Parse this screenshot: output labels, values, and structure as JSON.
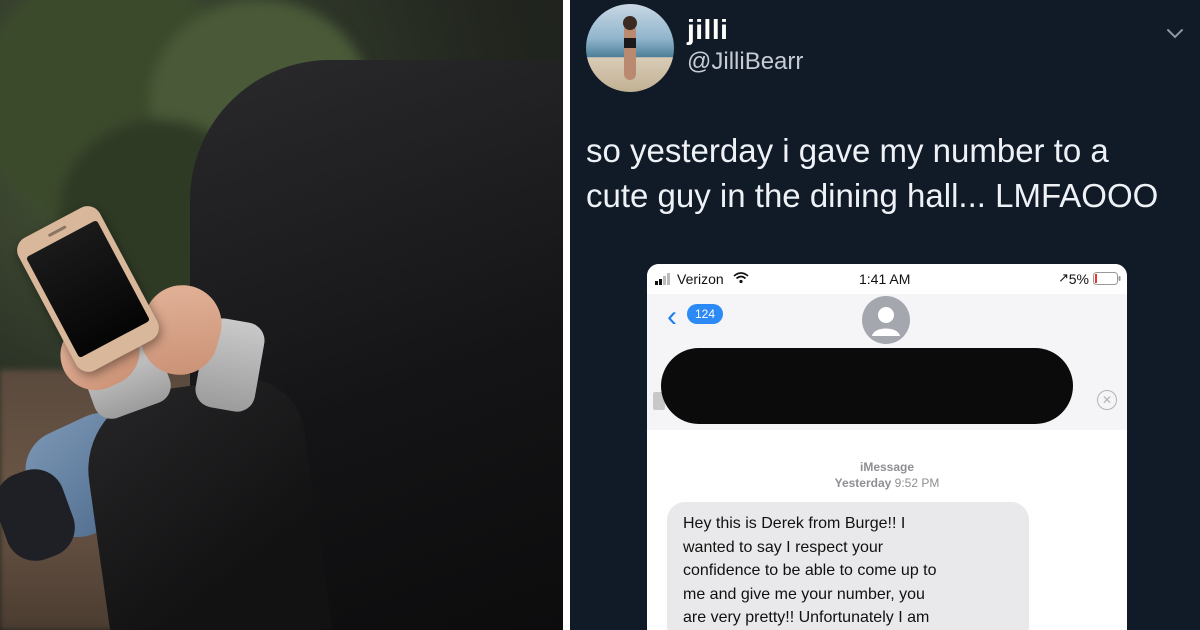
{
  "tweet": {
    "display_name": "jilli",
    "handle": "@JilliBearr",
    "text_line1": "so yesterday i gave my number to a",
    "text_line2": "cute guy in the dining hall... LMFAOOO"
  },
  "screenshot": {
    "status_bar": {
      "carrier": "Verizon",
      "time": "1:41 AM",
      "battery": "5%"
    },
    "back_count": "124",
    "thread_meta_service": "iMessage",
    "thread_meta_day": "Yesterday",
    "thread_meta_time": "9:52 PM",
    "message_lines": [
      "Hey this is Derek from Burge!! I",
      "wanted to say I respect your",
      "confidence to be able to come up to",
      "me and give me your number, you",
      "are very pretty!! Unfortunately I am"
    ]
  },
  "colors": {
    "tweet_background": "#111a27",
    "imessage_blue": "#2b8af6",
    "bubble_gray": "#e9e9eb"
  }
}
